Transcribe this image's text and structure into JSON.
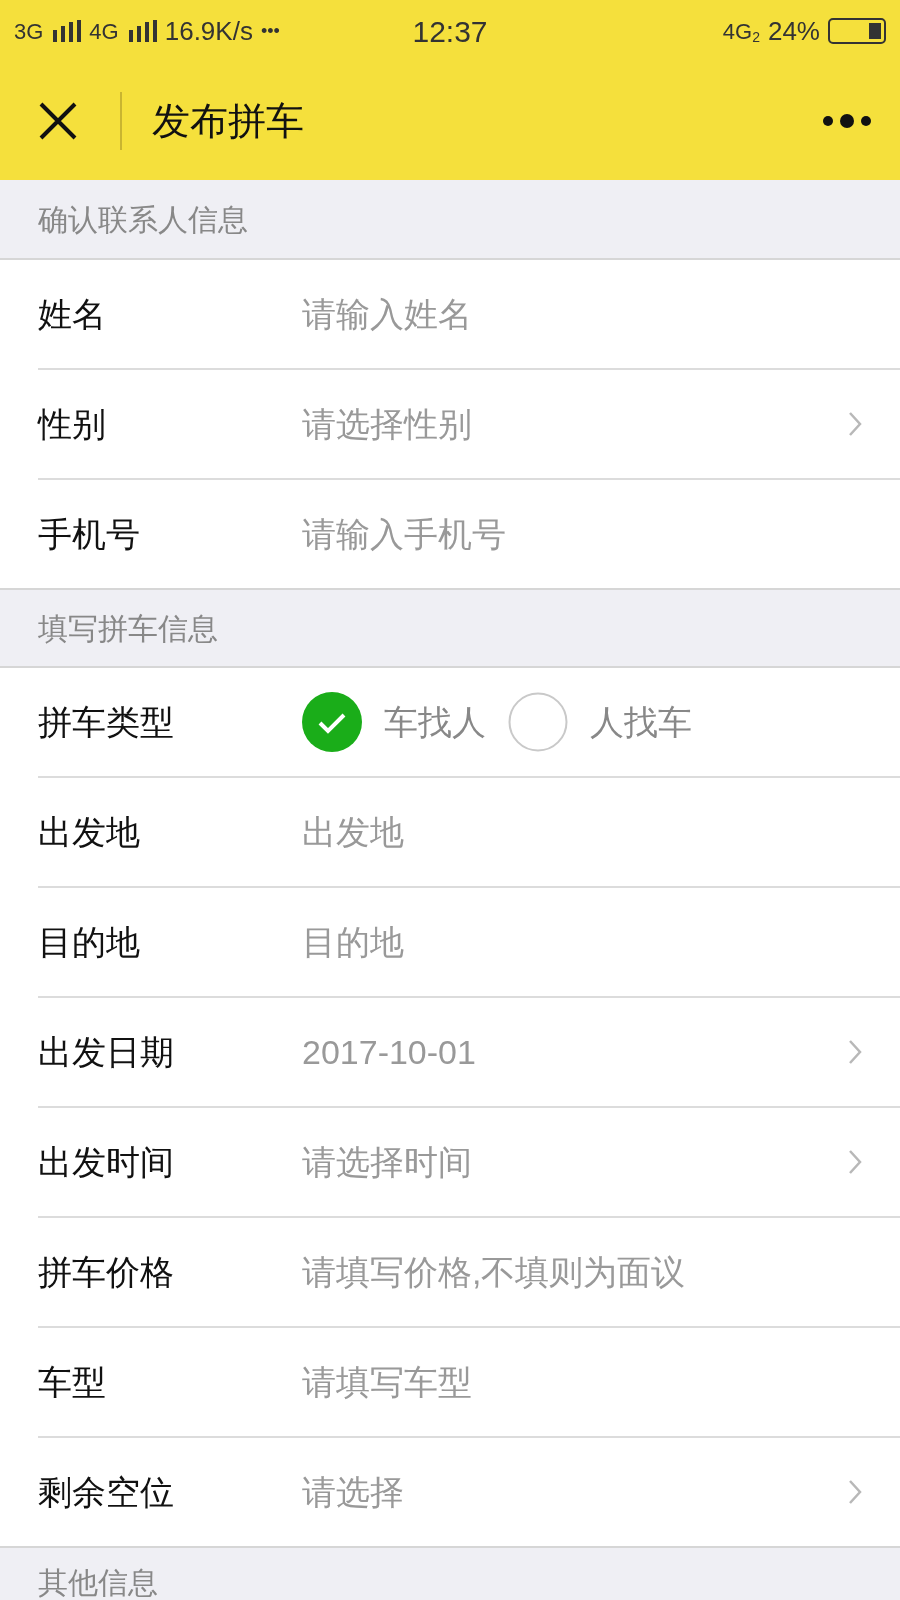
{
  "status_bar": {
    "left": [
      "3G",
      "4G"
    ],
    "speed": "16.9K/s",
    "dots": "•••",
    "time": "12:37",
    "network": "4G",
    "network_sub": "2",
    "battery": "24%"
  },
  "nav": {
    "title": "发布拼车"
  },
  "sections": [
    {
      "title": "确认联系人信息",
      "rows": [
        {
          "kind": "input",
          "label": "姓名",
          "placeholder": "请输入姓名"
        },
        {
          "kind": "select",
          "label": "性别",
          "placeholder": "请选择性别"
        },
        {
          "kind": "input",
          "label": "手机号",
          "placeholder": "请输入手机号"
        }
      ]
    },
    {
      "title": "填写拼车信息",
      "rows": [
        {
          "kind": "radio",
          "label": "拼车类型",
          "options": [
            {
              "label": "车找人",
              "selected": true
            },
            {
              "label": "人找车",
              "selected": false
            }
          ]
        },
        {
          "kind": "input",
          "label": "出发地",
          "placeholder": "出发地"
        },
        {
          "kind": "input",
          "label": "目的地",
          "placeholder": "目的地"
        },
        {
          "kind": "select",
          "label": "出发日期",
          "value": "2017-10-01"
        },
        {
          "kind": "select",
          "label": "出发时间",
          "placeholder": "请选择时间"
        },
        {
          "kind": "input",
          "label": "拼车价格",
          "placeholder": "请填写价格,不填则为面议"
        },
        {
          "kind": "input",
          "label": "车型",
          "placeholder": "请填写车型"
        },
        {
          "kind": "select",
          "label": "剩余空位",
          "placeholder": "请选择"
        }
      ]
    },
    {
      "title": "其他信息"
    }
  ]
}
